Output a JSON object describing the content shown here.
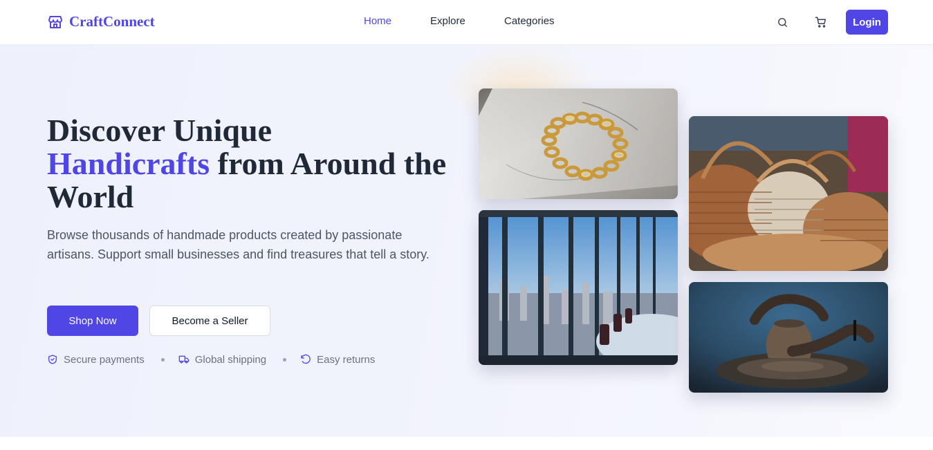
{
  "brand": {
    "name": "CraftConnect",
    "icon": "store-icon",
    "color": "#4f46e5"
  },
  "nav": {
    "items": [
      {
        "label": "Home",
        "active": true
      },
      {
        "label": "Explore",
        "active": false
      },
      {
        "label": "Categories",
        "active": false
      }
    ],
    "search_icon": "search-icon",
    "cart_icon": "cart-icon",
    "login_label": "Login"
  },
  "hero": {
    "headline_part1": "Discover Unique",
    "headline_accent": "Handicrafts",
    "headline_part2": "from Around the World",
    "subtext": "Browse thousands of handmade products created by passionate artisans. Support small businesses and find treasures that tell a story.",
    "primary_cta": "Shop Now",
    "secondary_cta": "Become a Seller",
    "features": [
      {
        "icon": "shield-check-icon",
        "label": "Secure payments"
      },
      {
        "icon": "truck-icon",
        "label": "Global shipping"
      },
      {
        "icon": "rotate-ccw-icon",
        "label": "Easy returns"
      }
    ]
  },
  "gallery": {
    "images": [
      {
        "subject": "gold chain bracelet"
      },
      {
        "subject": "woven wicker baskets"
      },
      {
        "subject": "office with city view"
      },
      {
        "subject": "hands shaping clay pot on wheel"
      }
    ]
  },
  "colors": {
    "accent": "#4f46e5",
    "text": "#1f2937",
    "muted": "#6b7280",
    "hero_bg": "#f1f3fc"
  }
}
